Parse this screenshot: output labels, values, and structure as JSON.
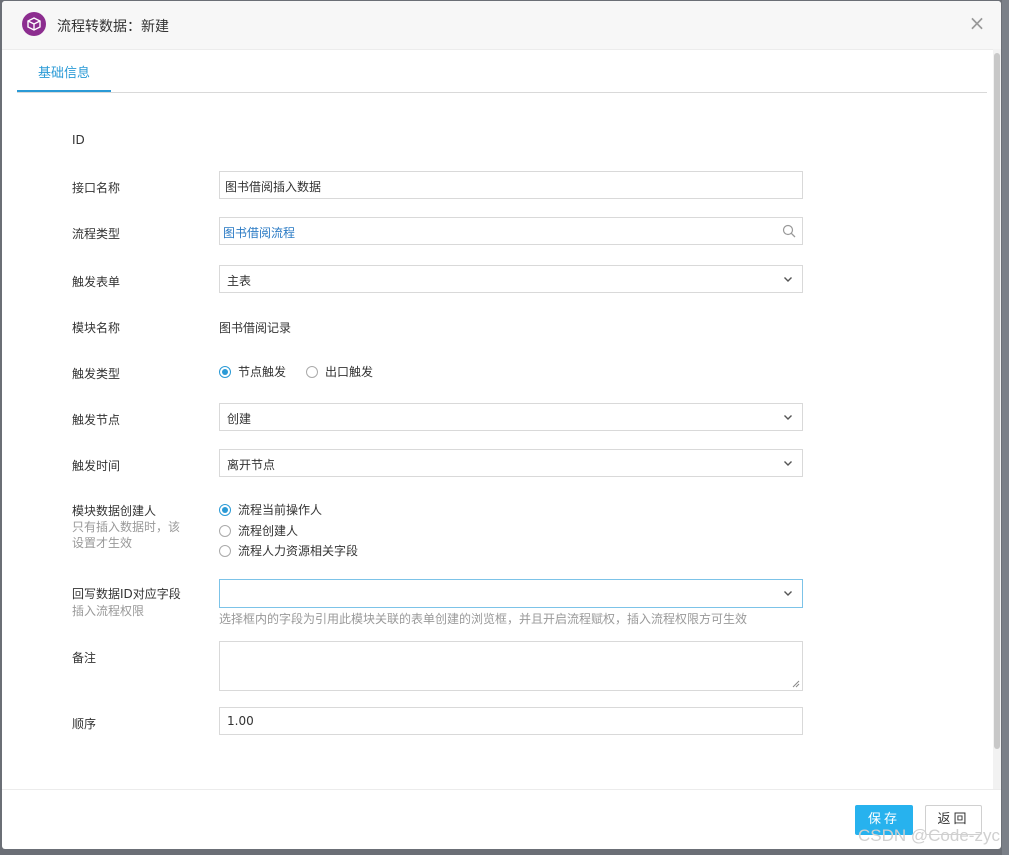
{
  "dialog": {
    "title": "流程转数据：新建",
    "close_glyph": "×"
  },
  "tabs": [
    {
      "label": "基础信息",
      "active": true
    }
  ],
  "form": {
    "id_label": "ID",
    "interface_name": {
      "label": "接口名称",
      "value": "图书借阅插入数据"
    },
    "flow_type": {
      "label": "流程类型",
      "value": "图书借阅流程"
    },
    "trigger_form": {
      "label": "触发表单",
      "value": "主表"
    },
    "module_name": {
      "label": "模块名称",
      "value": "图书借阅记录"
    },
    "trigger_type": {
      "label": "触发类型",
      "options": [
        {
          "label": "节点触发",
          "checked": true
        },
        {
          "label": "出口触发",
          "checked": false
        }
      ]
    },
    "trigger_node": {
      "label": "触发节点",
      "value": "创建"
    },
    "trigger_time": {
      "label": "触发时间",
      "value": "离开节点"
    },
    "module_creator": {
      "label": "模块数据创建人",
      "sublabel_line1": "只有插入数据时，该",
      "sublabel_line2": "设置才生效",
      "options": [
        {
          "label": "流程当前操作人",
          "checked": true
        },
        {
          "label": "流程创建人",
          "checked": false
        },
        {
          "label": "流程人力资源相关字段",
          "checked": false
        }
      ]
    },
    "writeback_field": {
      "label": "回写数据ID对应字段",
      "sublabel": "插入流程权限",
      "value": "",
      "hint": "选择框内的字段为引用此模块关联的表单创建的浏览框，并且开启流程赋权，插入流程权限方可生效"
    },
    "remarks": {
      "label": "备注",
      "value": ""
    },
    "order": {
      "label": "顺序",
      "value": "1.00"
    }
  },
  "footer": {
    "save_label": "保存",
    "back_label": "返回"
  },
  "watermark": "CSDN @Code-zyc",
  "colors": {
    "accent": "#2a9ad6",
    "save_button": "#27b2ee",
    "app_icon": "#8c2d8f"
  }
}
